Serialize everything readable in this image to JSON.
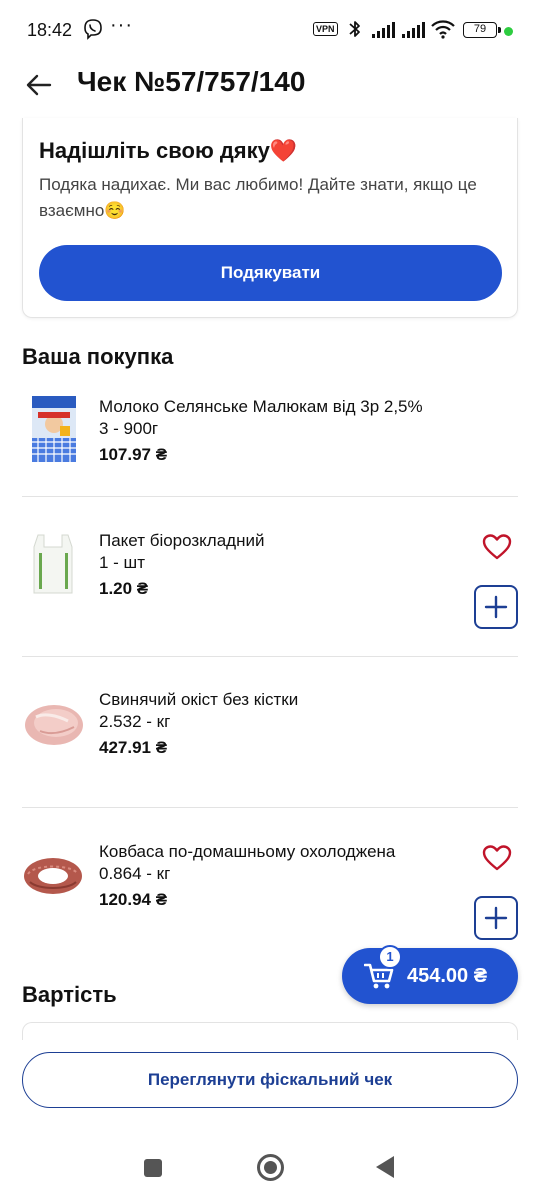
{
  "status_bar": {
    "time": "18:42",
    "dots": "···",
    "vpn": "VPN",
    "battery": "79"
  },
  "header": {
    "title": "Чек №57/757/140"
  },
  "thanks_card": {
    "title": "Надішліть свою дяку❤️",
    "text": "Подяка надихає. Ми вас любимо! Дайте знати, якщо це взаємно☺️",
    "button": "Подякувати"
  },
  "purchase": {
    "title": "Ваша покупка",
    "items": [
      {
        "name": "Молоко Селянське Малюкам від 3р 2,5%",
        "qty": "3 - 900г",
        "price": "107.97 ₴",
        "image": "milk-pack-image"
      },
      {
        "name": "Пакет біорозкладний",
        "qty": "1 - шт",
        "price": "1.20 ₴",
        "image": "bag-image"
      },
      {
        "name": "Свинячий окіст без кістки",
        "qty": "2.532 - кг",
        "price": "427.91 ₴",
        "image": "pork-image"
      },
      {
        "name": "Ковбаса по-домашньому охолоджена",
        "qty": "0.864 - кг",
        "price": "120.94 ₴",
        "image": "sausage-image"
      }
    ]
  },
  "cart": {
    "count": "1",
    "total": "454.00 ₴"
  },
  "cost": {
    "title": "Вартість"
  },
  "fiscal": {
    "button": "Переглянути фіскальний чек"
  },
  "colors": {
    "primary": "#2253d0",
    "primary_dark": "#1d3f94",
    "heart": "#c0142a"
  }
}
